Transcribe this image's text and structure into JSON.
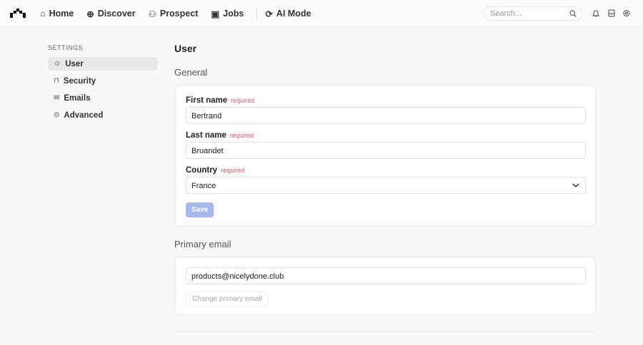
{
  "nav": {
    "items": [
      {
        "label": "Home",
        "icon": "home-icon"
      },
      {
        "label": "Discover",
        "icon": "globe-icon"
      },
      {
        "label": "Prospect",
        "icon": "users-icon"
      },
      {
        "label": "Jobs",
        "icon": "briefcase-icon"
      },
      {
        "label": "AI Mode",
        "icon": "ai-icon"
      }
    ],
    "search_placeholder": "Search..."
  },
  "sidebar": {
    "heading": "SETTINGS",
    "items": [
      {
        "label": "User"
      },
      {
        "label": "Security"
      },
      {
        "label": "Emails"
      },
      {
        "label": "Advanced"
      }
    ]
  },
  "page": {
    "title": "User",
    "general": "General",
    "first_name_label": "First name",
    "last_name_label": "Last name",
    "country_label": "Country",
    "required": "required",
    "first_name": "Bertrand",
    "last_name": "Bruandet",
    "country": "France",
    "save": "Save",
    "primary_email_title": "Primary email",
    "email": "products@nicelydone.club",
    "change_email": "Change primary email"
  },
  "colors": {
    "accent": "#a9b8ec",
    "required": "#e0566a"
  }
}
